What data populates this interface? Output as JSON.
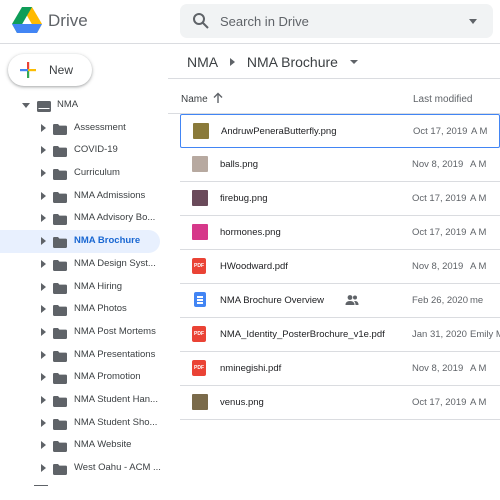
{
  "header": {
    "brand": "Drive",
    "search_placeholder": "Search in Drive"
  },
  "sidebar": {
    "new_label": "New",
    "root": "NMA",
    "folders": [
      "Assessment",
      "COVID-19",
      "Curriculum",
      "NMA Admissions",
      "NMA Advisory Bo...",
      "NMA Brochure",
      "NMA Design Syst...",
      "NMA Hiring",
      "NMA Photos",
      "NMA Post Mortems",
      "NMA Presentations",
      "NMA Promotion",
      "NMA Student Han...",
      "NMA Student Sho...",
      "NMA Website",
      "West Oahu - ACM ..."
    ],
    "selected_folder": "NMA Brochure"
  },
  "breadcrumb": {
    "parent": "NMA",
    "current": "NMA Brochure"
  },
  "columns": {
    "name": "Name",
    "modified": "Last modified"
  },
  "files": [
    {
      "name": "AndruwPeneraButterfly.png",
      "date": "Oct 17, 2019",
      "owner": "A M",
      "type": "image",
      "thumb": "#8a7a3a"
    },
    {
      "name": "balls.png",
      "date": "Nov 8, 2019",
      "owner": "A M",
      "type": "image",
      "thumb": "#b7a9a0"
    },
    {
      "name": "firebug.png",
      "date": "Oct 17, 2019",
      "owner": "A M",
      "type": "image",
      "thumb": "#6a4a5a"
    },
    {
      "name": "hormones.png",
      "date": "Oct 17, 2019",
      "owner": "A M",
      "type": "image",
      "thumb": "#d6388a"
    },
    {
      "name": "HWoodward.pdf",
      "date": "Nov 8, 2019",
      "owner": "A M",
      "type": "pdf"
    },
    {
      "name": "NMA Brochure Overview",
      "date": "Feb 26, 2020",
      "owner": "me",
      "type": "doc",
      "shared": true
    },
    {
      "name": "NMA_Identity_PosterBrochure_v1e.pdf",
      "date": "Jan 31, 2020",
      "owner": "Emily M",
      "type": "pdf"
    },
    {
      "name": "nminegishi.pdf",
      "date": "Nov 8, 2019",
      "owner": "A M",
      "type": "pdf"
    },
    {
      "name": "venus.png",
      "date": "Oct 17, 2019",
      "owner": "A M",
      "type": "image",
      "thumb": "#7a6a4a"
    }
  ],
  "pdf_badge_text": "PDF",
  "colors": {
    "accent": "#1967d2",
    "selected_bg": "#e8f0fe",
    "pdf_red": "#ea4335",
    "doc_blue": "#4285f4"
  }
}
